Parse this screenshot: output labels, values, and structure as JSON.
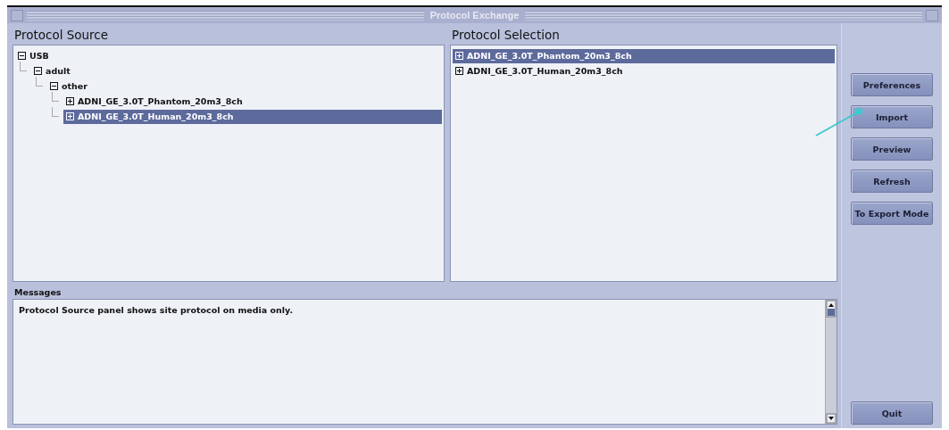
{
  "window": {
    "title": "Protocol Exchange"
  },
  "protocol_source": {
    "heading": "Protocol Source",
    "tree": [
      {
        "label": "USB",
        "expanded": true,
        "selected": false,
        "children": [
          {
            "label": "adult",
            "expanded": true,
            "selected": false,
            "children": [
              {
                "label": "other",
                "expanded": true,
                "selected": false,
                "children": [
                  {
                    "label": "ADNI_GE_3.0T_Phantom_20m3_8ch",
                    "expanded": false,
                    "selected": false
                  },
                  {
                    "label": "ADNI_GE_3.0T_Human_20m3_8ch",
                    "expanded": false,
                    "selected": true
                  }
                ]
              }
            ]
          }
        ]
      }
    ]
  },
  "protocol_selection": {
    "heading": "Protocol Selection",
    "items": [
      {
        "label": "ADNI_GE_3.0T_Phantom_20m3_8ch",
        "expanded": false,
        "selected": true
      },
      {
        "label": "ADNI_GE_3.0T_Human_20m3_8ch",
        "expanded": false,
        "selected": false
      }
    ]
  },
  "messages": {
    "heading": "Messages",
    "text": "Protocol Source panel shows site protocol on media only."
  },
  "buttons": [
    "Preferences",
    "Import",
    "Preview",
    "Refresh",
    "To Export Mode"
  ],
  "quit_button": "Quit"
}
